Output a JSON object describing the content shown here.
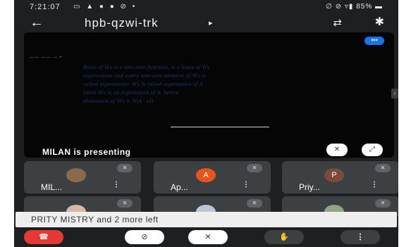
{
  "status_bar": {
    "time": "7:21:07",
    "notification_icons": "▭ ▲ ● ● ⊘ •",
    "system_icons": "∅ ⊘ ▿▮ 85% ▬"
  },
  "header": {
    "back_icon": "arrow-left-icon",
    "back_glyph": "←",
    "meeting_code": "hpb-qzwi-trk",
    "caret_glyph": "▸",
    "camera_switch_glyph": "⇄",
    "bluetooth_glyph": "✱"
  },
  "presentation": {
    "menu_glyph": "•••",
    "small_text": "—— ——  —  •",
    "handwriting_lines": [
      "Basis of Wx is a non-zero function, is a basis of Wx",
      "eigenvalues and every non-zero element of Wx is",
      "called eigenvector. Wx is called eigenspace of A",
      "there Wx is an eigenspace of A, hence",
      "dimension of Wx = N(A - xI)"
    ],
    "presenting_label": "MILAN is presenting",
    "pin_glyph": "✕",
    "fullscreen_glyph": "⤢",
    "side_chevron_glyph": "‹"
  },
  "participants": [
    {
      "name": "MIL...",
      "avatar_type": "photo",
      "avatar_color": "#8a6a4a"
    },
    {
      "name": "Ap...",
      "avatar_type": "letter",
      "avatar_letter": "A",
      "avatar_color": "#e8541e"
    },
    {
      "name": "Priy...",
      "avatar_type": "letter",
      "avatar_letter": "P",
      "avatar_color": "#7b4b3a"
    },
    {
      "name": "",
      "avatar_type": "photo",
      "avatar_color": "#d9b8a8"
    },
    {
      "name": "",
      "avatar_type": "photo",
      "avatar_color": "#b9c6d6"
    },
    {
      "name": "",
      "avatar_type": "photo",
      "avatar_color": "#8fa58a"
    }
  ],
  "mute_glyph": "✕",
  "tile_menu_glyph": "⋮",
  "toast": {
    "message": "PRITY MISTRY and 2 more left"
  },
  "controls": {
    "end_call_glyph": "☎",
    "camera_glyph": "⊘",
    "mic_glyph": "✕",
    "raise_hand_glyph": "✋",
    "more_glyph": "⋮"
  },
  "colors": {
    "end_call": "#e53935",
    "meeting_accent": "#1a73e8"
  }
}
